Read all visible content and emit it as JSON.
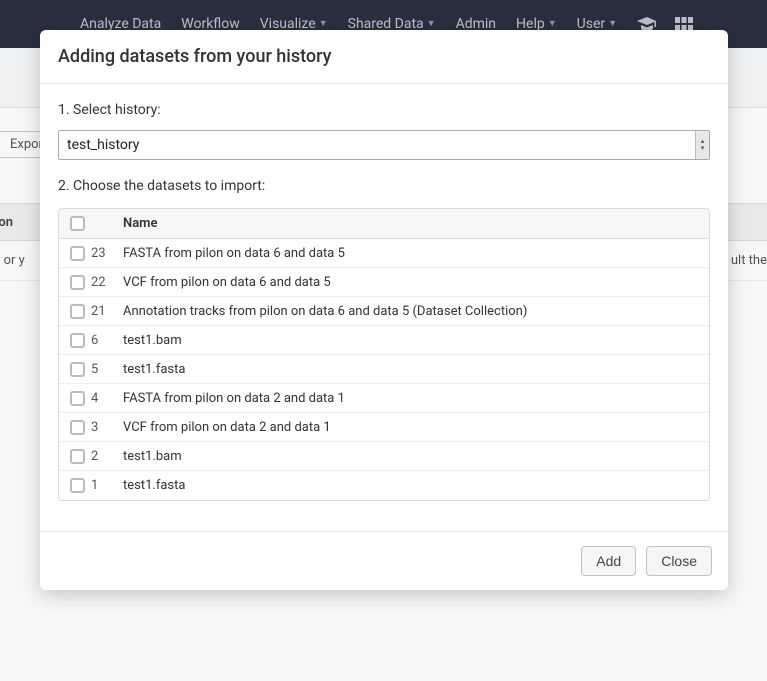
{
  "nav": {
    "analyze": "Analyze Data",
    "workflow": "Workflow",
    "visualize": "Visualize",
    "shared": "Shared Data",
    "admin": "Admin",
    "help": "Help",
    "user": "User"
  },
  "background": {
    "export_btn": "Export",
    "description_col": "iption",
    "empty_left": "ty or y",
    "empty_right": "ult the"
  },
  "modal": {
    "title": "Adding datasets from your history",
    "step1": "1. Select history:",
    "selected_history": "test_history",
    "step2": "2. Choose the datasets to import:",
    "name_header": "Name",
    "rows": [
      {
        "id": "23",
        "name": "FASTA from pilon on data 6 and data 5"
      },
      {
        "id": "22",
        "name": "VCF from pilon on data 6 and data 5"
      },
      {
        "id": "21",
        "name": "Annotation tracks from pilon on data 6 and data 5 (Dataset Collection)"
      },
      {
        "id": "6",
        "name": "test1.bam"
      },
      {
        "id": "5",
        "name": "test1.fasta"
      },
      {
        "id": "4",
        "name": "FASTA from pilon on data 2 and data 1"
      },
      {
        "id": "3",
        "name": "VCF from pilon on data 2 and data 1"
      },
      {
        "id": "2",
        "name": "test1.bam"
      },
      {
        "id": "1",
        "name": "test1.fasta"
      }
    ],
    "add_btn": "Add",
    "close_btn": "Close"
  }
}
